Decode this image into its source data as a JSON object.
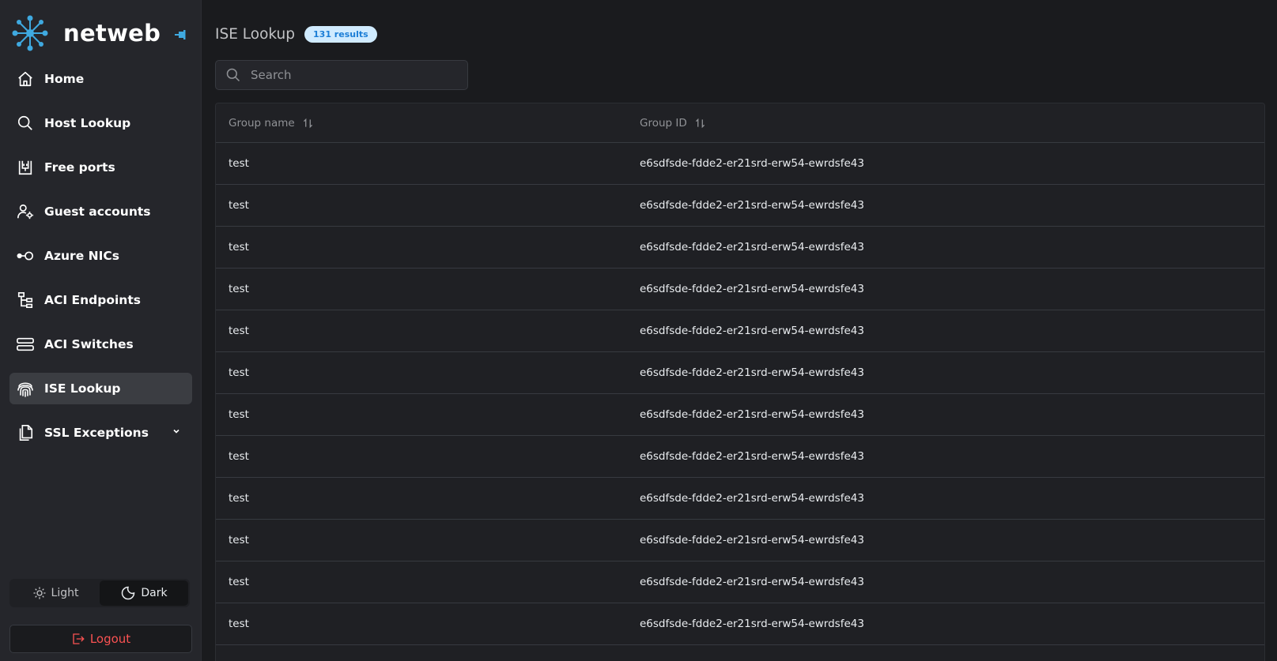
{
  "app": {
    "name": "netweb"
  },
  "sidebar": {
    "items": [
      {
        "label": "Home",
        "icon": "home-icon",
        "active": false
      },
      {
        "label": "Host Lookup",
        "icon": "search-icon",
        "active": false
      },
      {
        "label": "Free ports",
        "icon": "port-icon",
        "active": false
      },
      {
        "label": "Guest accounts",
        "icon": "user-settings-icon",
        "active": false
      },
      {
        "label": "Azure NICs",
        "icon": "nic-icon",
        "active": false
      },
      {
        "label": "ACI Endpoints",
        "icon": "hierarchy-icon",
        "active": false
      },
      {
        "label": "ACI Switches",
        "icon": "server-icon",
        "active": false
      },
      {
        "label": "ISE Lookup",
        "icon": "fingerprint-icon",
        "active": true
      },
      {
        "label": "SSL Exceptions",
        "icon": "files-icon",
        "active": false,
        "has_submenu": true
      }
    ],
    "theme": {
      "light_label": "Light",
      "dark_label": "Dark",
      "selected": "Dark"
    },
    "logout_label": "Logout"
  },
  "main": {
    "title": "ISE Lookup",
    "results_badge": "131 results",
    "search": {
      "placeholder": "Search",
      "value": ""
    },
    "table": {
      "columns": [
        "Group name",
        "Group ID"
      ],
      "rows": [
        [
          "test",
          "e6sdfsde-fdde2-er21srd-erw54-ewrdsfe43"
        ],
        [
          "test",
          "e6sdfsde-fdde2-er21srd-erw54-ewrdsfe43"
        ],
        [
          "test",
          "e6sdfsde-fdde2-er21srd-erw54-ewrdsfe43"
        ],
        [
          "test",
          "e6sdfsde-fdde2-er21srd-erw54-ewrdsfe43"
        ],
        [
          "test",
          "e6sdfsde-fdde2-er21srd-erw54-ewrdsfe43"
        ],
        [
          "test",
          "e6sdfsde-fdde2-er21srd-erw54-ewrdsfe43"
        ],
        [
          "test",
          "e6sdfsde-fdde2-er21srd-erw54-ewrdsfe43"
        ],
        [
          "test",
          "e6sdfsde-fdde2-er21srd-erw54-ewrdsfe43"
        ],
        [
          "test",
          "e6sdfsde-fdde2-er21srd-erw54-ewrdsfe43"
        ],
        [
          "test",
          "e6sdfsde-fdde2-er21srd-erw54-ewrdsfe43"
        ],
        [
          "test",
          "e6sdfsde-fdde2-er21srd-erw54-ewrdsfe43"
        ],
        [
          "test",
          "e6sdfsde-fdde2-er21srd-erw54-ewrdsfe43"
        ]
      ]
    }
  },
  "colors": {
    "background": "#1a1b1e",
    "sidebar": "#25262b",
    "active_item": "#3b3d42",
    "accent": "#228be6",
    "badge_bg": "#d0ebff",
    "badge_text": "#1c7ed6",
    "logout": "#fa5252"
  }
}
